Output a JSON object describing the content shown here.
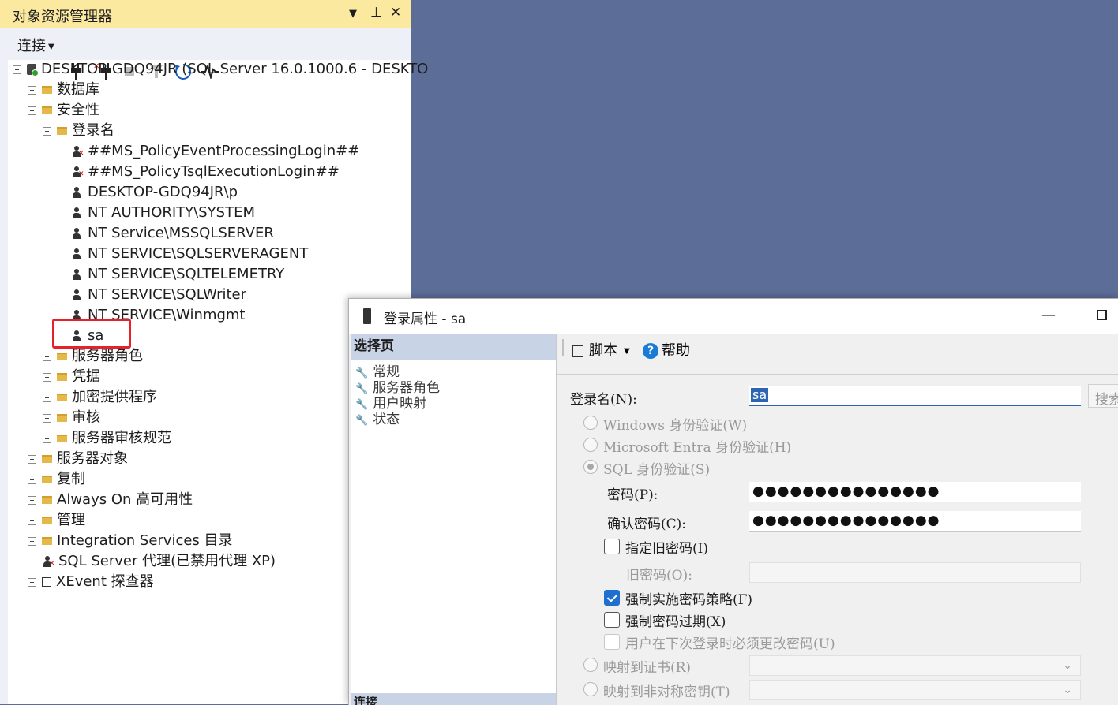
{
  "object_explorer": {
    "title": "对象资源管理器",
    "title_buttons": [
      "▼",
      "⊥",
      "✕"
    ],
    "toolbar": {
      "connect_label": "连接",
      "icons": [
        "connect-icon",
        "disconnect-icon",
        "stop-icon",
        "filter-icon",
        "refresh-icon",
        "activity-monitor-icon"
      ]
    },
    "tree": {
      "server": "DESKTOP-GDQ94JR (SQL Server 16.0.1000.6 - DESKTO",
      "databases": "数据库",
      "security": "安全性",
      "logins": "登录名",
      "login_items": [
        "##MS_PolicyEventProcessingLogin##",
        "##MS_PolicyTsqlExecutionLogin##",
        "DESKTOP-GDQ94JR\\p",
        "NT AUTHORITY\\SYSTEM",
        "NT Service\\MSSQLSERVER",
        "NT SERVICE\\SQLSERVERAGENT",
        "NT SERVICE\\SQLTELEMETRY",
        "NT SERVICE\\SQLWriter",
        "NT SERVICE\\Winmgmt",
        "sa"
      ],
      "security_children": [
        "服务器角色",
        "凭据",
        "加密提供程序",
        "审核",
        "服务器审核规范"
      ],
      "top_items": [
        "服务器对象",
        "复制",
        "Always On 高可用性",
        "管理",
        "Integration Services 目录"
      ],
      "agent": "SQL Server 代理(已禁用代理 XP)",
      "xevent": "XEvent 探查器"
    }
  },
  "dialog": {
    "title": "登录属性 - sa",
    "select_page_header": "选择页",
    "pages": [
      "常规",
      "服务器角色",
      "用户映射",
      "状态"
    ],
    "footer_header": "连接",
    "toolbar": {
      "script": "脚本",
      "help": "帮助"
    },
    "form": {
      "login_name_label": "登录名(N):",
      "login_name_value": "sa",
      "search_button": "搜索",
      "windows_auth": "Windows 身份验证(W)",
      "entra_auth": "Microsoft Entra 身份验证(H)",
      "sql_auth": "SQL 身份验证(S)",
      "password_label": "密码(P):",
      "password_value": "●●●●●●●●●●●●●●●",
      "confirm_label": "确认密码(C):",
      "confirm_value": "●●●●●●●●●●●●●●●",
      "specify_old": "指定旧密码(I)",
      "old_password_label": "旧密码(O):",
      "enforce_policy": "强制实施密码策略(F)",
      "enforce_expiration": "强制密码过期(X)",
      "must_change": "用户在下次登录时必须更改密码(U)",
      "map_cert": "映射到证书(R)",
      "map_asym": "映射到非对称密钥(T)"
    }
  }
}
